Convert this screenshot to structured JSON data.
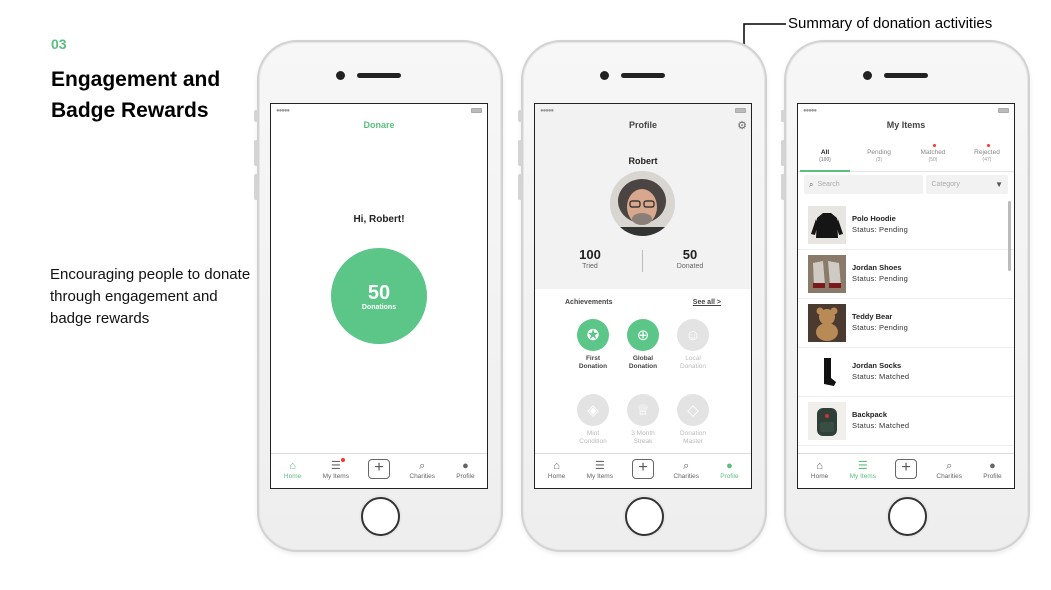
{
  "left": {
    "step_number": "03",
    "headline": "Engagement and Badge Rewards",
    "description": "Encouraging people to donate through engagement and badge rewards"
  },
  "callout": {
    "text": "Summary of donation activities"
  },
  "tabbar": {
    "home": "Home",
    "my_items": "My Items",
    "charities": "Charities",
    "profile": "Profile",
    "add_symbol": "+"
  },
  "screen_home": {
    "title": "Donare",
    "greeting": "Hi, Robert!",
    "donation_count": "50",
    "donation_label": "Donations"
  },
  "screen_profile": {
    "title": "Profile",
    "name": "Robert",
    "stats": [
      {
        "value": "100",
        "label": "Tried"
      },
      {
        "value": "50",
        "label": "Donated"
      }
    ],
    "achievements_title": "Achievements",
    "see_all": "See all >",
    "badges": [
      {
        "line1": "First",
        "line2": "Donation",
        "earned": true,
        "icon": "ribbon-icon"
      },
      {
        "line1": "Global",
        "line2": "Donation",
        "earned": true,
        "icon": "globe-icon"
      },
      {
        "line1": "Local",
        "line2": "Donation",
        "earned": false,
        "icon": "smile-icon"
      },
      {
        "line1": "Mint",
        "line2": "Condition",
        "earned": false,
        "icon": "tag-icon"
      },
      {
        "line1": "3 Month",
        "line2": "Streak",
        "earned": false,
        "icon": "trophy-icon"
      },
      {
        "line1": "Donation",
        "line2": "Master",
        "earned": false,
        "icon": "diamond-icon"
      }
    ]
  },
  "screen_items": {
    "title": "My Items",
    "segments": [
      {
        "label": "All",
        "count": "(100)",
        "active": true,
        "dot": false
      },
      {
        "label": "Pending",
        "count": "(3)",
        "active": false,
        "dot": false
      },
      {
        "label": "Matched",
        "count": "(50)",
        "active": false,
        "dot": true
      },
      {
        "label": "Rejected",
        "count": "(47)",
        "active": false,
        "dot": true
      }
    ],
    "search_placeholder": "Search",
    "category_placeholder": "Category",
    "items": [
      {
        "name": "Polo Hoodie",
        "status": "Status: Pending"
      },
      {
        "name": "Jordan Shoes",
        "status": "Status: Pending"
      },
      {
        "name": "Teddy Bear",
        "status": "Status: Pending"
      },
      {
        "name": "Jordan Socks",
        "status": "Status: Matched"
      },
      {
        "name": "Backpack",
        "status": "Status: Matched"
      }
    ]
  },
  "colors": {
    "accent": "#5bbf7e",
    "badge_off": "#e3e3e3",
    "notification": "#ff3030"
  }
}
